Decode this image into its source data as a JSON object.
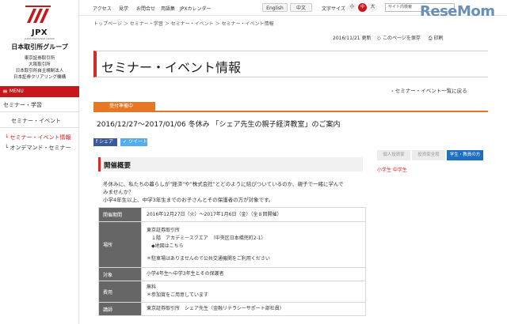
{
  "colors": {
    "accent_red": "#c8161d",
    "orange_tab": "#e87725",
    "table_header": "#666666",
    "resemom_blue": "#6a8fb6"
  },
  "sidebar": {
    "logo_text": "JPX",
    "logo_subtext": "JAPAN EXCHANGE GROUP",
    "group_name": "日本取引所グループ",
    "companies": [
      "東京証券取引所",
      "大阪取引所",
      "日本取引所自主規制法人",
      "日本証券クリアリング機構"
    ],
    "menu_label": "MENU",
    "nav": [
      {
        "label": "セミナー・学習"
      },
      {
        "label": "セミナー・イベント"
      },
      {
        "label": "セミナー・イベント情報"
      },
      {
        "label": "オンデマンド・セミナー"
      }
    ]
  },
  "topbar": {
    "links": [
      "アクセス",
      "見学",
      "お問合せ",
      "用語集",
      "JPXカレンダー"
    ],
    "lang_en": "English",
    "lang_zh": "中文",
    "fontsize_label": "文字サイズ",
    "fontsize_small": "小",
    "fontsize_medium": "中",
    "fontsize_large": "大",
    "search_placeholder": "サイト内検索",
    "brand": "ReseMom"
  },
  "breadcrumb": {
    "items": [
      "トップページ",
      "セミナー・学習",
      "セミナー・イベント",
      "セミナー・イベント情報"
    ],
    "separator": "＞"
  },
  "date_row": {
    "date": "2016/11/21 更新",
    "bookmark": "このページを保存",
    "print": "印刷"
  },
  "page_title": "セミナー・イベント情報",
  "back_link": "セミナー・イベント一覧に戻る",
  "reception": "受付準備中",
  "event_title": "2016/12/27～2017/01/06 冬休み 「シェア先生の親子経済教室」のご案内",
  "share": {
    "facebook": "シェア",
    "twitter": "ツイート"
  },
  "filter_tabs": [
    "個人投資家",
    "投資家全般",
    "学生・教員の方"
  ],
  "target_tags": "小学生 中学生",
  "section": {
    "title": "開催概要",
    "desc": [
      "冬休みに、私たちの暮らしが\"経済\"や\"株式会社\"とどのように結びついているのか、親子で一緒に学んで",
      "みませんか？",
      "小学4年生以上、中学3年生までのお子さんとその保護者の方が対象です。"
    ]
  },
  "table": {
    "rows": [
      {
        "header": "開催期間",
        "lines": [
          "2016年12月27日（火）～2017年1月6日（金）（全８回開催）"
        ]
      },
      {
        "header": "場所",
        "lines": [
          "東京証券取引所",
          "　１階　アカデミースクエア　（中央区日本橋兜町2-1）",
          "　◆地図はこちら",
          "",
          "＊駐車場はありませんので公共交通機関をご利用ください"
        ]
      },
      {
        "header": "対象",
        "lines": [
          "小学4年生～中学3年生とその保護者"
        ]
      },
      {
        "header": "費用",
        "lines": [
          "無料",
          "＊参加賞をご用意しています"
        ]
      },
      {
        "header": "講師",
        "lines": [
          "東京証券取引所　シェア先生（金融リテラシーサポート部社員）"
        ]
      }
    ]
  }
}
